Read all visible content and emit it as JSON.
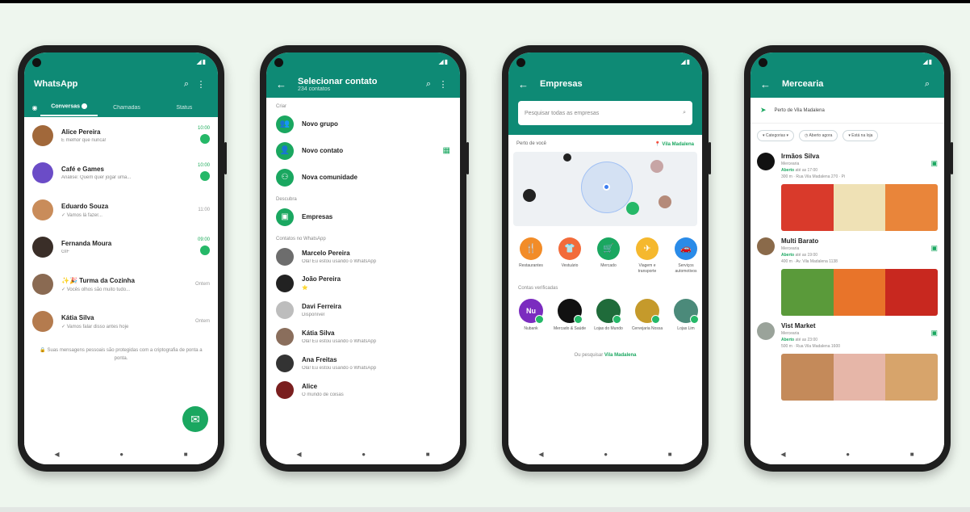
{
  "colors": {
    "brand_green": "#0e8a75",
    "accent_green": "#1aa760",
    "unread_green": "#25b868"
  },
  "phone1": {
    "title": "WhatsApp",
    "tabs": [
      "Conversas",
      "Chamadas",
      "Status"
    ],
    "chats": [
      {
        "name": "Alice Pereira",
        "msg": "É melhor que nunca!",
        "time": "10:00",
        "unread": "1",
        "avatar_color": "#a1683a"
      },
      {
        "name": "Café e Games",
        "msg": "Análise: Quem quer jogar uma...",
        "time": "10:00",
        "unread": "2",
        "avatar_color": "#6b4cc7"
      },
      {
        "name": "Eduardo Souza",
        "msg": "✓ Vamos lá fazer...",
        "time": "11:00",
        "unread": "",
        "avatar_color": "#c98c5a"
      },
      {
        "name": "Fernanda Moura",
        "msg": "GIF",
        "time": "09:00",
        "unread": "1",
        "avatar_color": "#3a2e28"
      },
      {
        "name": "✨🎉 Turma da Cozinha",
        "msg": "✓ Vocês olhos são muito tudo...",
        "time": "Ontem",
        "unread": "",
        "avatar_color": "#8a6a52"
      },
      {
        "name": "Kátia Silva",
        "msg": "✓ Vamos falar disso antes hoje",
        "time": "Ontem",
        "unread": "",
        "avatar_color": "#b47b4e"
      }
    ],
    "footer_note": "🔒 Suas mensagens pessoais são protegidas com a criptografia de ponta a ponta."
  },
  "phone2": {
    "title": "Selecionar contato",
    "subtitle": "234 contatos",
    "section_new": "Criar",
    "actions": [
      "Novo grupo",
      "Novo contato",
      "Nova comunidade"
    ],
    "section_search": "Descubra",
    "business": "Empresas",
    "section_contacts": "Contatos no WhatsApp",
    "contacts": [
      {
        "name": "Marcelo Pereira",
        "msg": "Olá! Eu estou usando o WhatsApp",
        "avatar_color": "#6d6d6d"
      },
      {
        "name": "João Pereira",
        "msg": "⭐",
        "avatar_color": "#222222"
      },
      {
        "name": "Davi Ferreira",
        "msg": "Disponível",
        "avatar_color": "#bdbdbd"
      },
      {
        "name": "Kátia Silva",
        "msg": "Olá! Eu estou usando o WhatsApp",
        "avatar_color": "#8a6e5c"
      },
      {
        "name": "Ana Freitas",
        "msg": "Olá! Eu estou usando o WhatsApp",
        "avatar_color": "#333333"
      },
      {
        "name": "Alice",
        "msg": "O mundo de coisas",
        "avatar_color": "#7a1f1f"
      }
    ]
  },
  "phone3": {
    "title": "Empresas",
    "search_placeholder": "Pesquisar todas as empresas",
    "near_label": "Perto de você",
    "near_location": "📍 Vila Madalena",
    "categories": [
      {
        "label": "Restaurantes",
        "color": "#f28c28",
        "icon": "🍴"
      },
      {
        "label": "Vestuário",
        "color": "#f26b3a",
        "icon": "👕"
      },
      {
        "label": "Mercado",
        "color": "#1aa760",
        "icon": "🛒"
      },
      {
        "label": "Viagem e transporte",
        "color": "#f5b82e",
        "icon": "✈"
      },
      {
        "label": "Serviços automotivos",
        "color": "#2a8be8",
        "icon": "🚗"
      }
    ],
    "section_verified": "Contas verificadas",
    "shops": [
      {
        "name": "Nubank",
        "color": "#7b2cbf",
        "logo": "Nu"
      },
      {
        "name": "Mercado & Saúde",
        "color": "#111111",
        "logo": ""
      },
      {
        "name": "Lojas do Mundo",
        "color": "#1f6b3a",
        "logo": ""
      },
      {
        "name": "Cervejaria Nossa",
        "color": "#c59a2b",
        "logo": ""
      },
      {
        "name": "Lojas Lim",
        "color": "#4b8a7a",
        "logo": ""
      }
    ],
    "browse_text": "Ou pesquisar",
    "browse_link": "Vila Madalena"
  },
  "phone4": {
    "title": "Mercearia",
    "location": "Perto de Vila Madalena",
    "filters": [
      "▾ Categorias ▾",
      "◷ Aberto agora",
      "▾ Está na loja"
    ],
    "businesses": [
      {
        "name": "Irmãos Silva",
        "category": "Mercearia",
        "status": "Aberto",
        "hours": "até as 17:00",
        "address": "300 m · Rua Vila Madalena 270 · Pi",
        "avatar_color": "#111111",
        "photos": [
          "#d93a2b",
          "#efe1b5",
          "#e9853a"
        ]
      },
      {
        "name": "Multi Barato",
        "category": "Mercearia",
        "status": "Aberto",
        "hours": "até as 19:00",
        "address": "400 m · Av. Vila Madalena 1138",
        "avatar_color": "#8a6a4a",
        "photos": [
          "#5a9a3a",
          "#e8742a",
          "#c8281f"
        ]
      },
      {
        "name": "Vist Market",
        "category": "Mercearia",
        "status": "Aberto",
        "hours": "até as 23:00",
        "address": "500 m · Rua Vila Madalena 1600",
        "avatar_color": "#9aa39a",
        "photos": [
          "#c48a5a",
          "#e6b6a8",
          "#d7a46b"
        ]
      }
    ]
  }
}
